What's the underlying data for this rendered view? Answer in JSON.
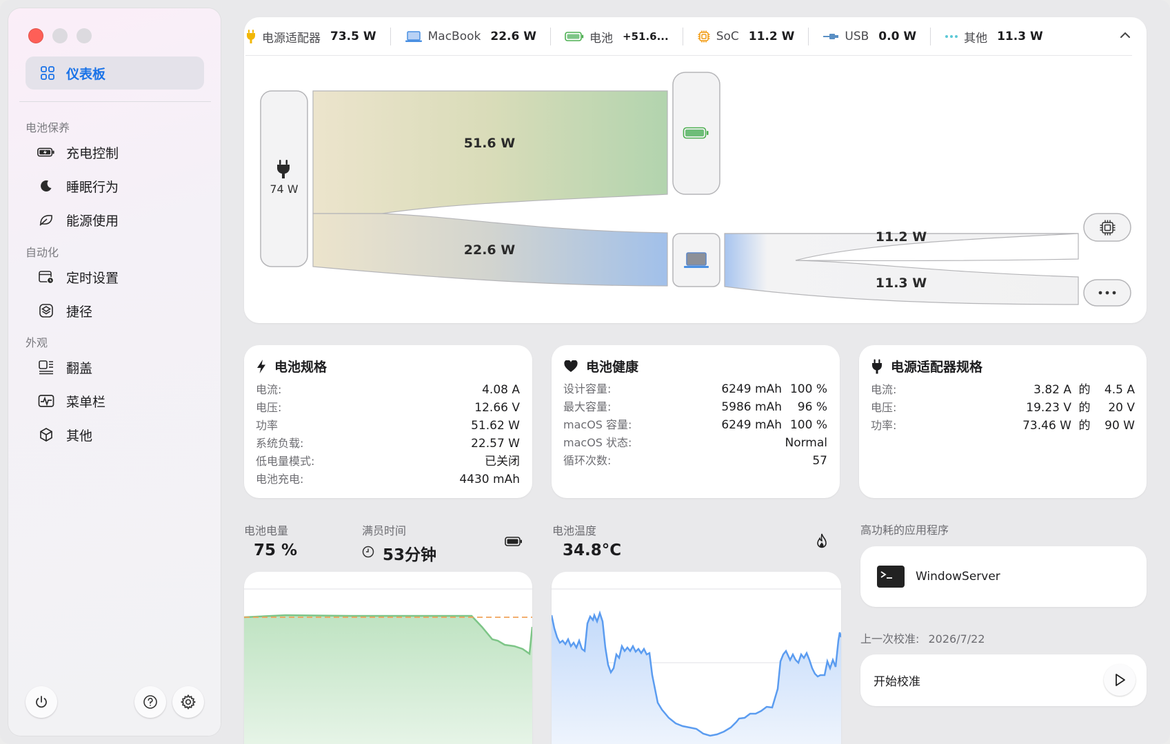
{
  "sidebar": {
    "active_item": "仪表板",
    "sections": [
      {
        "title": "电池保养",
        "items": [
          "充电控制",
          "睡眠行为",
          "能源使用"
        ]
      },
      {
        "title": "自动化",
        "items": [
          "定时设置",
          "捷径"
        ]
      },
      {
        "title": "外观",
        "items": [
          "翻盖",
          "菜单栏",
          "其他"
        ]
      }
    ]
  },
  "topbar": {
    "items": [
      {
        "name": "电源适配器",
        "value": "73.5 W",
        "icon": "plug-icon",
        "color": "#f2b705"
      },
      {
        "name": "MacBook",
        "value": "22.6 W",
        "icon": "laptop-icon",
        "color": "#4a90e2"
      },
      {
        "name": "电池",
        "value": "+51.6...",
        "icon": "battery-icon",
        "color": "#4caf50"
      },
      {
        "name": "SoC",
        "value": "11.2 W",
        "icon": "chip-icon",
        "color": "#f29b12"
      },
      {
        "name": "USB",
        "value": "0.0 W",
        "icon": "usb-icon",
        "color": "#5a8fc4"
      },
      {
        "name": "其他",
        "value": "11.3 W",
        "icon": "dots-icon",
        "color": "#5bc8d6"
      }
    ]
  },
  "flow": {
    "source": "74 W",
    "to_battery": "51.6 W",
    "to_system": "22.6 W",
    "to_soc": "11.2 W",
    "to_other": "11.3 W"
  },
  "battery_spec": {
    "title": "电池规格",
    "rows": [
      {
        "label": "电流:",
        "value": "4.08 A"
      },
      {
        "label": "电压:",
        "value": "12.66 V"
      },
      {
        "label": "功率",
        "value": "51.62 W"
      },
      {
        "label": "系统负载:",
        "value": "22.57 W"
      },
      {
        "label": "低电量模式:",
        "value": "已关闭"
      },
      {
        "label": "电池充电:",
        "value": "4430 mAh"
      }
    ]
  },
  "battery_health": {
    "title": "电池健康",
    "rows": [
      {
        "label": "设计容量:",
        "value": "6249 mAh",
        "pct": "100 %"
      },
      {
        "label": "最大容量:",
        "value": "5986 mAh",
        "pct": "96 %"
      },
      {
        "label": "macOS 容量:",
        "value": "6249 mAh",
        "pct": "100 %"
      },
      {
        "label": "macOS 状态:",
        "value": "Normal",
        "pct": ""
      },
      {
        "label": "循环次数:",
        "value": "57",
        "pct": ""
      }
    ]
  },
  "adapter_spec": {
    "title": "电源适配器规格",
    "of": "的",
    "rows": [
      {
        "label": "电流:",
        "value": "3.82 A",
        "max": "4.5 A"
      },
      {
        "label": "电压:",
        "value": "19.23 V",
        "max": "20 V"
      },
      {
        "label": "功率:",
        "value": "73.46 W",
        "max": "90 W"
      }
    ]
  },
  "battery_level": {
    "label": "电池电量",
    "value": "75 %"
  },
  "time_to_full": {
    "label": "满员时间",
    "value": "53分钟"
  },
  "battery_temp": {
    "label": "电池温度",
    "value": "34.8°C"
  },
  "high_power_apps": {
    "label": "高功耗的应用程序",
    "apps": [
      "WindowServer"
    ]
  },
  "calibration": {
    "last_label": "上一次校准:",
    "last_date": "2026/7/22",
    "button": "开始校准"
  },
  "colors": {
    "accent": "#1a73e8",
    "battery_green": "#7dc587",
    "target_orange": "#f0a35a",
    "temp_blue": "#5b9cf0"
  }
}
